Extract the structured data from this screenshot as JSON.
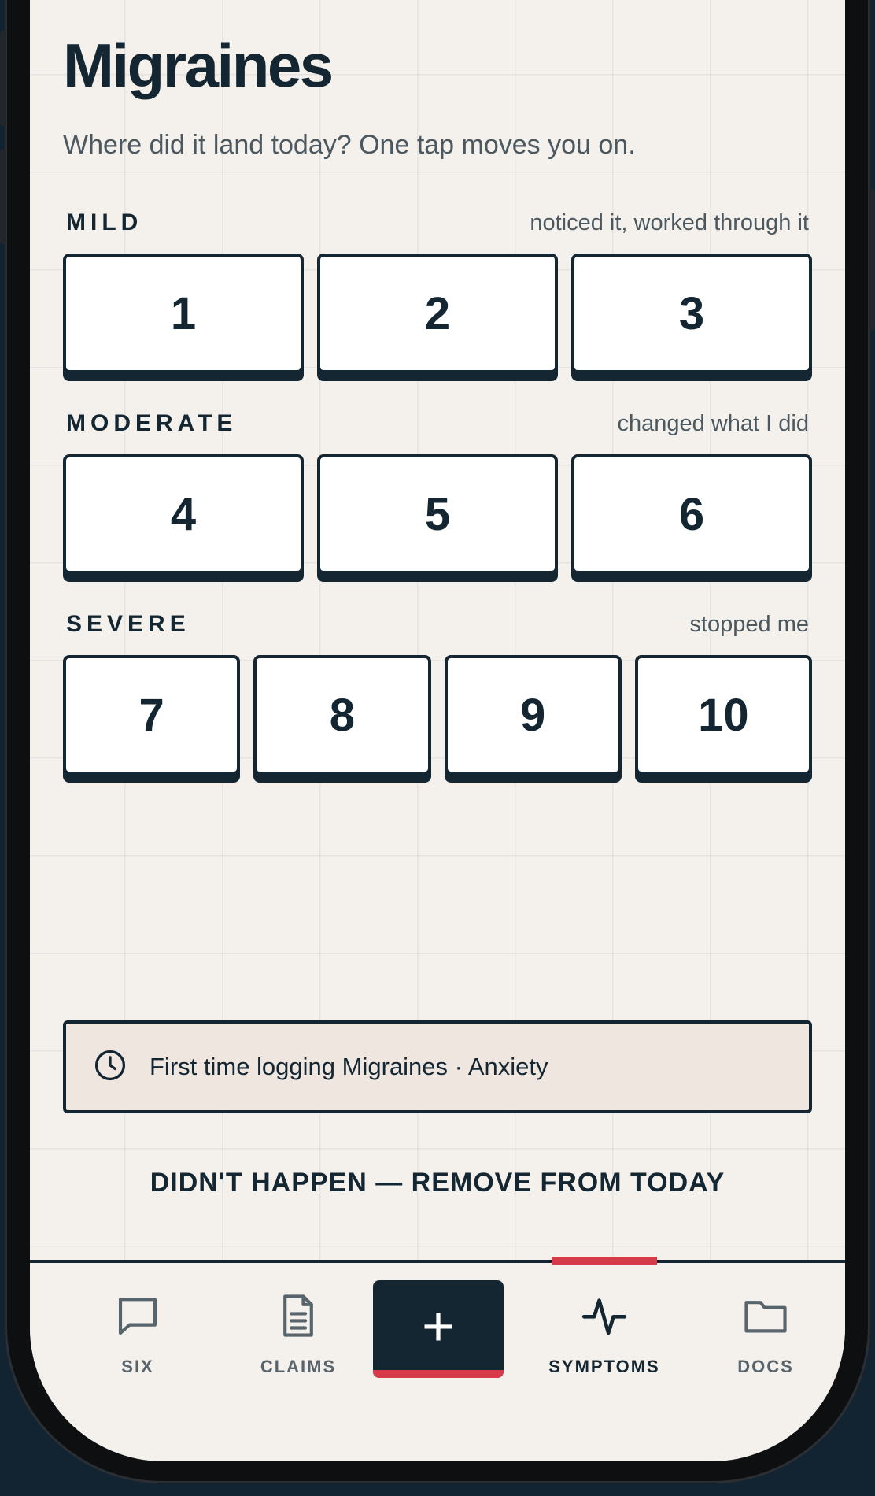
{
  "header": {
    "title": "Migraines",
    "subtitle": "Where did it land today? One tap moves you on."
  },
  "tiers": [
    {
      "label": "MILD",
      "description": "noticed it, worked through it",
      "values": [
        "1",
        "2",
        "3"
      ]
    },
    {
      "label": "MODERATE",
      "description": "changed what I did",
      "values": [
        "4",
        "5",
        "6"
      ]
    },
    {
      "label": "SEVERE",
      "description": "stopped me",
      "values": [
        "7",
        "8",
        "9",
        "10"
      ]
    }
  ],
  "history": {
    "icon": "clock-icon",
    "text": "First time logging Migraines · Anxiety"
  },
  "remove_label": "DIDN'T HAPPEN — REMOVE FROM TODAY",
  "tabs": [
    {
      "label": "SIX",
      "icon": "chat-bubble-icon"
    },
    {
      "label": "CLAIMS",
      "icon": "document-icon"
    },
    {
      "label": "SYMPTOMS",
      "icon": "pulse-icon",
      "active": true
    },
    {
      "label": "DOCS",
      "icon": "folder-icon"
    }
  ],
  "fab": {
    "symbol": "+",
    "icon": "plus-icon"
  },
  "colors": {
    "ink": "#132632",
    "background": "#f4f1ec",
    "accent": "#d63a48",
    "history_bg": "#efe6df"
  }
}
